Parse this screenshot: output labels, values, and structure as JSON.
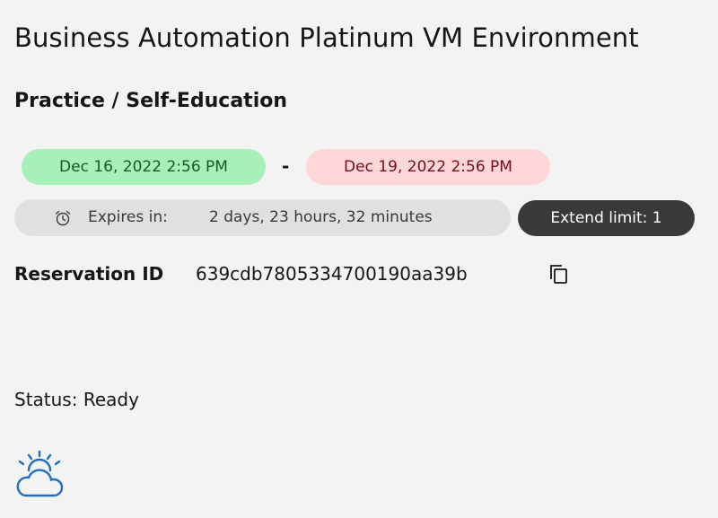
{
  "environment": {
    "title": "Business Automation Platinum VM Environment",
    "purpose": "Practice / Self-Education"
  },
  "reservation_window": {
    "start": "Dec 16, 2022 2:56 PM",
    "separator": "-",
    "end": "Dec 19, 2022 2:56 PM"
  },
  "expiry": {
    "label": "Expires in:",
    "value": "2 days, 23 hours, 32 minutes",
    "icon": "alarm-clock-icon"
  },
  "extend": {
    "label": "Extend limit: 1"
  },
  "reservation": {
    "label": "Reservation ID",
    "id": "639cdb7805334700190aa39b",
    "copy_icon": "copy-icon"
  },
  "status": {
    "text": "Status: Ready"
  },
  "brand": {
    "icon": "ibm-cloud-icon"
  },
  "colors": {
    "start_tag_bg": "#a7f0ba",
    "start_tag_text": "#0e6027",
    "end_tag_bg": "#ffd7d9",
    "end_tag_text": "#750e13",
    "expires_bg": "#e0e0e0",
    "extend_bg": "#393939",
    "brand_blue": "#1f70c1"
  }
}
